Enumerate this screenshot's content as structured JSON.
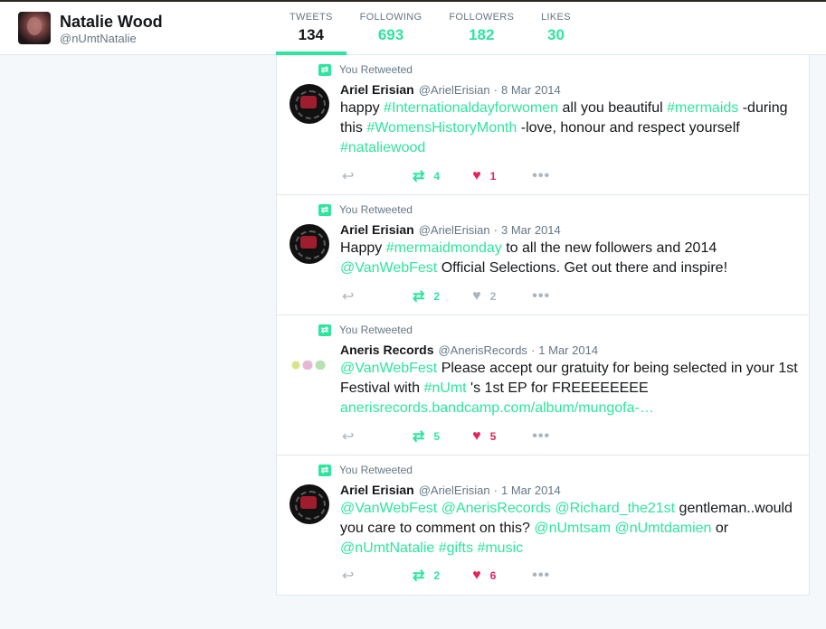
{
  "profile": {
    "name": "Natalie Wood",
    "handle": "@nUmtNatalie"
  },
  "stats": [
    {
      "label": "TWEETS",
      "value": "134"
    },
    {
      "label": "FOLLOWING",
      "value": "693"
    },
    {
      "label": "FOLLOWERS",
      "value": "182"
    },
    {
      "label": "LIKES",
      "value": "30"
    }
  ],
  "tweets": [
    {
      "rt_label": "You Retweeted",
      "name": "Ariel Erisian",
      "user": "@ArielErisian",
      "dot": "·",
      "date": "8 Mar 2014",
      "parts": [
        {
          "t": "happy ",
          "tag": false
        },
        {
          "t": "#Internationaldayforwomen",
          "tag": true
        },
        {
          "t": " all you beautiful ",
          "tag": false
        },
        {
          "t": "#mermaids",
          "tag": true
        },
        {
          "t": " -during this ",
          "tag": false
        },
        {
          "t": "#WomensHistoryMonth",
          "tag": true
        },
        {
          "t": " -love, honour and respect yourself ",
          "tag": false
        },
        {
          "t": "#nataliewood",
          "tag": true
        }
      ],
      "retweets": "4",
      "likes": "1",
      "liked": true
    },
    {
      "rt_label": "You Retweeted",
      "name": "Ariel Erisian",
      "user": "@ArielErisian",
      "dot": "·",
      "date": "3 Mar 2014",
      "parts": [
        {
          "t": "Happy ",
          "tag": false
        },
        {
          "t": "#mermaidmonday",
          "tag": true
        },
        {
          "t": " to all the new followers and 2014 ",
          "tag": false
        },
        {
          "t": "@VanWebFest",
          "tag": true
        },
        {
          "t": " Official Selections. Get out there and inspire!",
          "tag": false
        }
      ],
      "retweets": "2",
      "likes": "2",
      "liked": false
    },
    {
      "rt_label": "You Retweeted",
      "name": "Aneris Records",
      "user": "@AnerisRecords",
      "dot": "·",
      "date": "1 Mar 2014",
      "parts": [
        {
          "t": "@VanWebFest",
          "tag": true
        },
        {
          "t": " Please accept our gratuity for being selected in your 1st Festival with ",
          "tag": false
        },
        {
          "t": "#nUmt",
          "tag": true
        },
        {
          "t": " 's 1st EP for FREEEEEEEE ",
          "tag": false
        },
        {
          "t": "anerisrecords.bandcamp.com/album/mungofa-…",
          "tag": true
        }
      ],
      "retweets": "5",
      "likes": "5",
      "liked": true
    },
    {
      "rt_label": "You Retweeted",
      "name": "Ariel Erisian",
      "user": "@ArielErisian",
      "dot": "·",
      "date": "1 Mar 2014",
      "parts": [
        {
          "t": "@VanWebFest",
          "tag": true
        },
        {
          "t": " ",
          "tag": false
        },
        {
          "t": "@AnerisRecords",
          "tag": true
        },
        {
          "t": " ",
          "tag": false
        },
        {
          "t": "@Richard_the21st",
          "tag": true
        },
        {
          "t": " gentleman..would you care to comment on this? ",
          "tag": false
        },
        {
          "t": "@nUmtsam",
          "tag": true
        },
        {
          "t": " ",
          "tag": false
        },
        {
          "t": "@nUmtdamien",
          "tag": true
        },
        {
          "t": " or ",
          "tag": false
        },
        {
          "t": "@nUmtNatalie",
          "tag": true
        },
        {
          "t": " ",
          "tag": false
        },
        {
          "t": "#gifts",
          "tag": true
        },
        {
          "t": " ",
          "tag": false
        },
        {
          "t": "#music",
          "tag": true
        }
      ],
      "retweets": "2",
      "likes": "6",
      "liked": true
    }
  ],
  "icons": {
    "reply": "reply-icon",
    "retweet": "retweet-icon",
    "like": "heart-icon",
    "more": "more-icon"
  },
  "colors": {
    "accent": "#2ee59d",
    "like": "#e0245e",
    "muted": "#657786"
  }
}
